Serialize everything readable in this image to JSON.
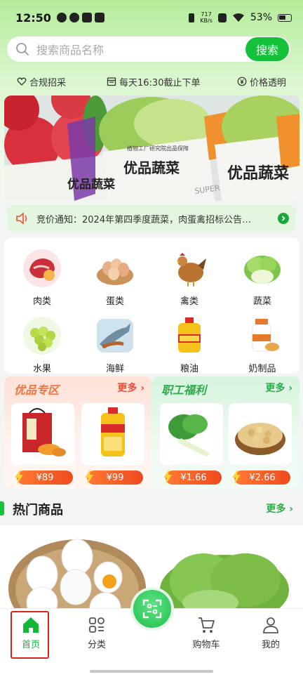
{
  "status_bar": {
    "time": "12:50",
    "net_speed_value": "717",
    "net_speed_unit": "KB/s",
    "battery": "53%"
  },
  "search": {
    "placeholder": "搜索商品名称",
    "button_label": "搜索"
  },
  "features": [
    {
      "label": "合规招采",
      "icon": "heart-shield-icon"
    },
    {
      "label": "每天16:30截止下单",
      "icon": "calendar-icon"
    },
    {
      "label": "价格透明",
      "icon": "yen-icon"
    }
  ],
  "banner": {
    "brand_text": "优品蔬菜",
    "sub_text": "SUPERIOR VEGETABLES",
    "factory_text": "植物工厂研究院出品保障"
  },
  "notice": {
    "icon": "speaker-icon",
    "text": "竞价通知：2024年第四季度蔬菜，肉蛋禽招标公告…"
  },
  "categories": [
    {
      "label": "肉类",
      "icon": "meat-icon"
    },
    {
      "label": "蛋类",
      "icon": "eggs-icon"
    },
    {
      "label": "禽类",
      "icon": "chicken-icon"
    },
    {
      "label": "蔬菜",
      "icon": "lettuce-icon"
    },
    {
      "label": "水果",
      "icon": "grapes-icon"
    },
    {
      "label": "海鲜",
      "icon": "fish-icon"
    },
    {
      "label": "粮油",
      "icon": "oil-icon"
    },
    {
      "label": "奶制品",
      "icon": "milk-icon"
    }
  ],
  "promo_left": {
    "title": "优品专区",
    "more": "更多",
    "products": [
      {
        "price": "¥89",
        "icon": "gift-box-icon"
      },
      {
        "price": "¥99",
        "icon": "oil-bottle-icon"
      }
    ]
  },
  "promo_right": {
    "title": "职工福利",
    "more": "更多",
    "products": [
      {
        "price": "¥1.66",
        "icon": "bok-choy-icon"
      },
      {
        "price": "¥2.66",
        "icon": "soybeans-icon"
      }
    ]
  },
  "hot": {
    "title": "热门商品",
    "more": "更多"
  },
  "nav": {
    "home": "首页",
    "category": "分类",
    "cart": "购物车",
    "mine": "我的"
  },
  "colors": {
    "accent": "#14c23a",
    "highlight_box": "#d8231c",
    "promo_left": "#f0753f",
    "promo_right": "#2faa4c"
  }
}
